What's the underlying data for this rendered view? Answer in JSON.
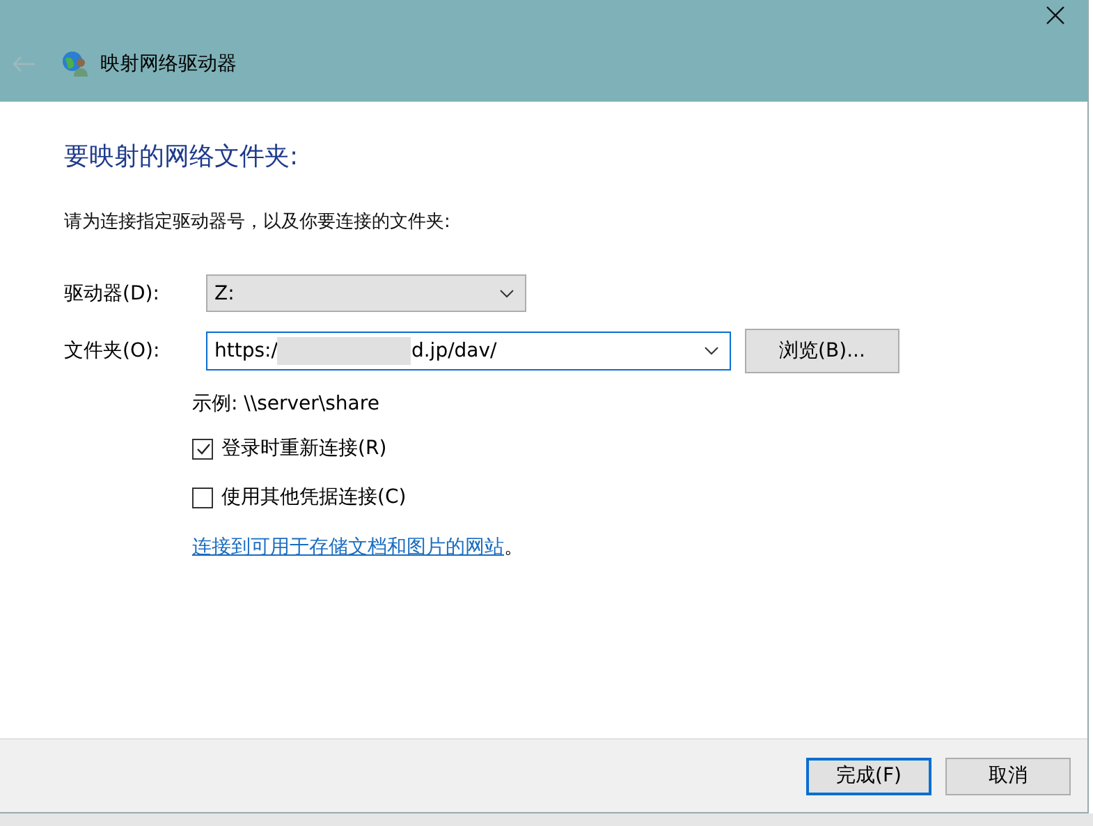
{
  "window": {
    "title": "映射网络驱动器",
    "back_disabled": true
  },
  "heading": "要映射的网络文件夹:",
  "instruction": "请为连接指定驱动器号，以及你要连接的文件夹:",
  "drive": {
    "label": "驱动器(D):",
    "value": "Z:"
  },
  "folder": {
    "label": "文件夹(O):",
    "value_start": "https:/",
    "redacted": true,
    "value_end": "d.jp/dav/"
  },
  "browse_button": "浏览(B)...",
  "example": "示例: \\\\server\\share",
  "options": [
    {
      "label": "登录时重新连接(R)",
      "checked": true
    },
    {
      "label": "使用其他凭据连接(C)",
      "checked": false
    }
  ],
  "link": "连接到可用于存储文档和图片的网站",
  "link_suffix": "。",
  "buttons": [
    {
      "label": "完成(F)",
      "default": true
    },
    {
      "label": "取消",
      "default": false
    }
  ]
}
